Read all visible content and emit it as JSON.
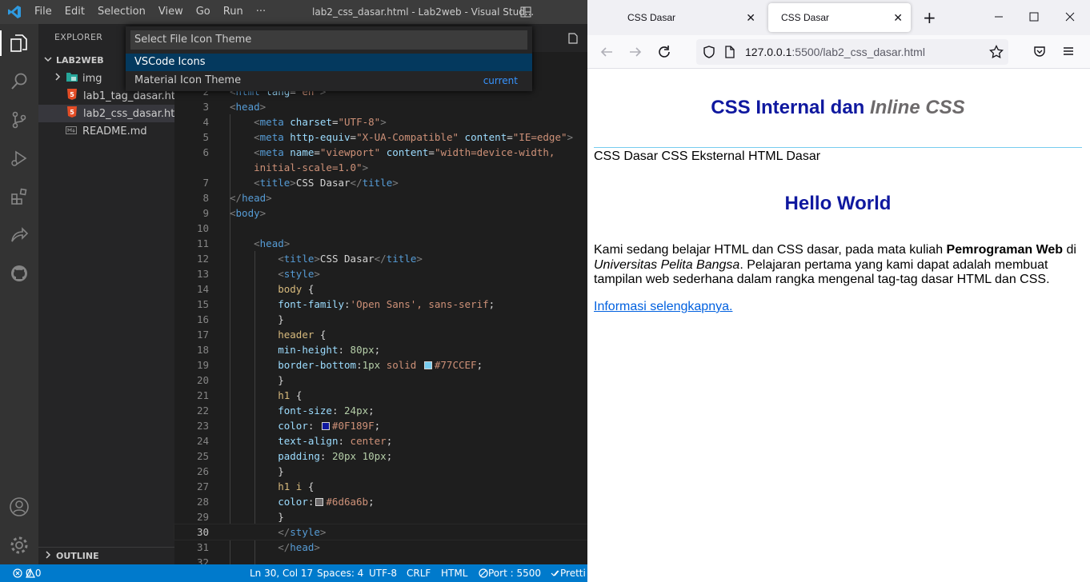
{
  "vscode": {
    "menu": [
      "File",
      "Edit",
      "Selection",
      "View",
      "Go",
      "Run",
      "···"
    ],
    "window_title": "lab2_css_dasar.html - Lab2web - Visual Stud...",
    "explorer": {
      "title": "EXPLORER",
      "folder": "LAB2WEB",
      "items": [
        {
          "label": "img",
          "type": "folder"
        },
        {
          "label": "lab1_tag_dasar.html",
          "type": "html"
        },
        {
          "label": "lab2_css_dasar.html",
          "type": "html"
        },
        {
          "label": "README.md",
          "type": "md"
        }
      ],
      "outline": "OUTLINE"
    },
    "quick_pick": {
      "placeholder": "Select File Icon Theme",
      "options": [
        {
          "label": "VSCode Icons",
          "hint": ""
        },
        {
          "label": "Material Icon Theme",
          "hint": "current"
        }
      ]
    },
    "status": {
      "problems": "0",
      "warnings": "0",
      "position": "Ln 30, Col 17",
      "spaces": "Spaces: 4",
      "encoding": "UTF-8",
      "eol": "CRLF",
      "language": "HTML",
      "port": "Port : 5500",
      "prettier": "Pretti"
    },
    "code_lines": [
      {
        "n": "2",
        "html": "<span class='p'>&lt;</span><span class='t'>html</span> <span class='a'>lang</span><span class='w'>=</span><span class='s'>\"en\"</span><span class='p'>&gt;</span>"
      },
      {
        "n": "3",
        "html": "<span class='p'>&lt;</span><span class='t'>head</span><span class='p'>&gt;</span>"
      },
      {
        "n": "4",
        "html": "    <span class='p'>&lt;</span><span class='t'>meta</span> <span class='a'>charset</span><span class='w'>=</span><span class='s'>\"UTF-8\"</span><span class='p'>&gt;</span>"
      },
      {
        "n": "5",
        "html": "    <span class='p'>&lt;</span><span class='t'>meta</span> <span class='a'>http-equiv</span><span class='w'>=</span><span class='s'>\"X-UA-Compatible\"</span> <span class='a'>content</span><span class='w'>=</span><span class='s'>\"IE=edge\"</span><span class='p'>&gt;</span>"
      },
      {
        "n": "6",
        "html": "    <span class='p'>&lt;</span><span class='t'>meta</span> <span class='a'>name</span><span class='w'>=</span><span class='s'>\"viewport\"</span> <span class='a'>content</span><span class='w'>=</span><span class='s'>\"width=device-width,</span>"
      },
      {
        "n": "",
        "html": "    <span class='s'>initial-scale=1.0\"</span><span class='p'>&gt;</span>"
      },
      {
        "n": "7",
        "html": "    <span class='p'>&lt;</span><span class='t'>title</span><span class='p'>&gt;</span><span class='w'>CSS Dasar</span><span class='p'>&lt;/</span><span class='t'>title</span><span class='p'>&gt;</span>"
      },
      {
        "n": "8",
        "html": "<span class='p'>&lt;/</span><span class='t'>head</span><span class='p'>&gt;</span>"
      },
      {
        "n": "9",
        "html": "<span class='p'>&lt;</span><span class='t'>body</span><span class='p'>&gt;</span>"
      },
      {
        "n": "10",
        "html": ""
      },
      {
        "n": "11",
        "html": "    <span class='p'>&lt;</span><span class='t'>head</span><span class='p'>&gt;</span>"
      },
      {
        "n": "12",
        "html": "        <span class='p'>&lt;</span><span class='t'>title</span><span class='p'>&gt;</span><span class='w'>CSS Dasar</span><span class='p'>&lt;/</span><span class='t'>title</span><span class='p'>&gt;</span>"
      },
      {
        "n": "13",
        "html": "        <span class='p'>&lt;</span><span class='t'>style</span><span class='p'>&gt;</span>"
      },
      {
        "n": "14",
        "html": "        <span class='sel'>body</span> <span class='w'>{</span>"
      },
      {
        "n": "15",
        "html": "        <span class='k'>font-family</span><span class='w'>:</span><span class='v'>'Open Sans', sans-serif</span><span class='w'>;</span>"
      },
      {
        "n": "16",
        "html": "        <span class='w'>}</span>"
      },
      {
        "n": "17",
        "html": "        <span class='sel'>header</span> <span class='w'>{</span>"
      },
      {
        "n": "18",
        "html": "        <span class='k'>min-height</span><span class='w'>: </span><span class='n'>80px</span><span class='w'>;</span>"
      },
      {
        "n": "19",
        "html": "        <span class='k'>border-bottom</span><span class='w'>:</span><span class='n'>1px</span> <span class='v'>solid</span> <span class='sw' style='background:#77CCEF'></span><span class='v'>#77CCEF</span><span class='w'>;</span>"
      },
      {
        "n": "20",
        "html": "        <span class='w'>}</span>"
      },
      {
        "n": "21",
        "html": "        <span class='sel'>h1</span> <span class='w'>{</span>"
      },
      {
        "n": "22",
        "html": "        <span class='k'>font-size</span><span class='w'>: </span><span class='n'>24px</span><span class='w'>;</span>"
      },
      {
        "n": "23",
        "html": "        <span class='k'>color</span><span class='w'>: </span><span class='sw' style='background:#0F189F'></span><span class='v'>#0F189F</span><span class='w'>;</span>"
      },
      {
        "n": "24",
        "html": "        <span class='k'>text-align</span><span class='w'>: </span><span class='v'>center</span><span class='w'>;</span>"
      },
      {
        "n": "25",
        "html": "        <span class='k'>padding</span><span class='w'>: </span><span class='n'>20px 10px</span><span class='w'>;</span>"
      },
      {
        "n": "26",
        "html": "        <span class='w'>}</span>"
      },
      {
        "n": "27",
        "html": "        <span class='sel'>h1 i</span> <span class='w'>{</span>"
      },
      {
        "n": "28",
        "html": "        <span class='k'>color</span><span class='w'>:</span><span class='sw' style='background:#6d6a6b'></span><span class='v'>#6d6a6b</span><span class='w'>;</span>"
      },
      {
        "n": "29",
        "html": "        <span class='w'>}</span>"
      },
      {
        "n": "30",
        "html": "        <span class='p'>&lt;/</span><span class='t'>style</span><span class='p'>&gt;</span>"
      },
      {
        "n": "31",
        "html": "        <span class='p'>&lt;/</span><span class='t'>head</span><span class='p'>&gt;</span>"
      },
      {
        "n": "32",
        "html": ""
      }
    ]
  },
  "firefox": {
    "tabs": [
      "CSS Dasar",
      "CSS Dasar"
    ],
    "url_host": "127.0.0.1",
    "url_rest": ":5500/lab2_css_dasar.html",
    "page": {
      "h1_main": "CSS Internal dan ",
      "h1_italic": "Inline CSS",
      "nav": "CSS Dasar CSS Eksternal HTML Dasar",
      "h2": "Hello World",
      "p1": "Kami sedang belajar HTML dan CSS dasar, pada mata kuliah ",
      "p_bold": "Pemrograman Web",
      "p2": " di ",
      "p_italic": "Universitas Pelita Bangsa",
      "p3": ". Pelajaran pertama yang kami dapat adalah membuat tampilan web sederhana dalam rangka mengenal tag-tag dasar HTML dan CSS.",
      "link": "Informasi selengkapnya."
    }
  }
}
